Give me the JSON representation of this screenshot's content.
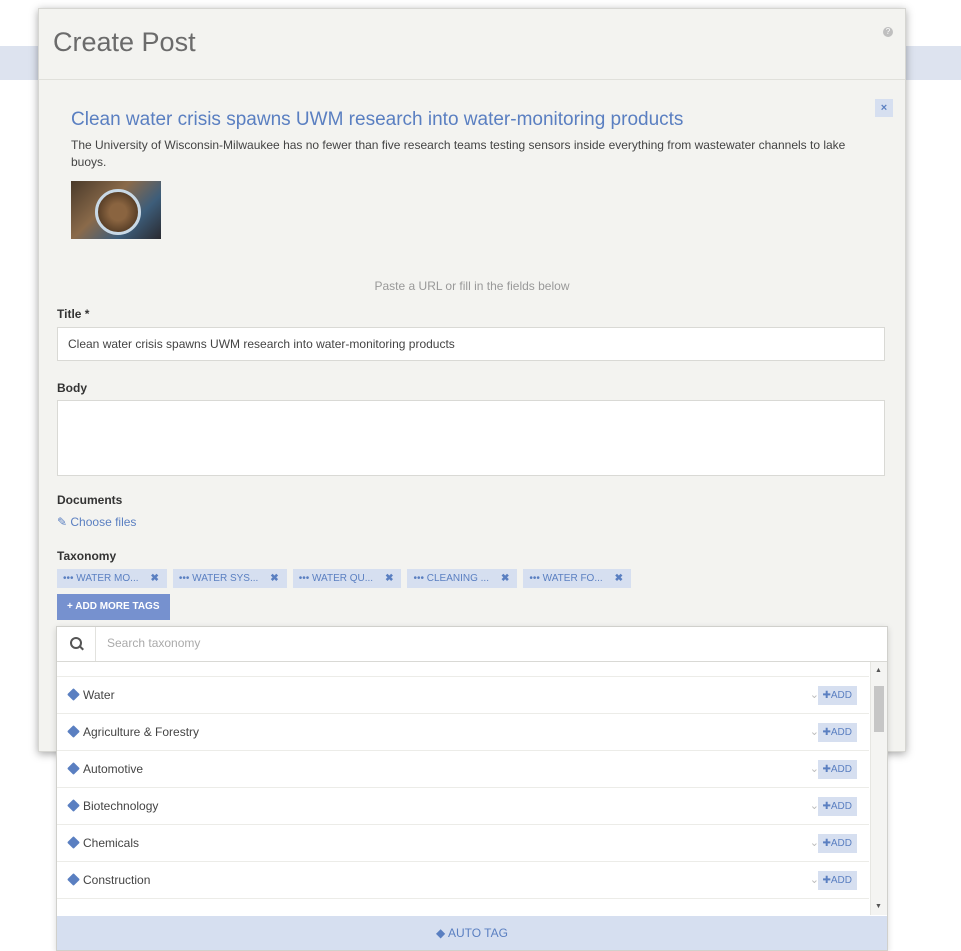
{
  "modal": {
    "title": "Create Post"
  },
  "preview": {
    "title": "Clean water crisis spawns UWM research into water-monitoring products",
    "description": "The University of Wisconsin-Milwaukee has no fewer than five research teams testing sensors inside everything from wastewater channels to lake buoys.",
    "close": "×"
  },
  "hint": "Paste a URL or fill in the fields below",
  "form": {
    "title_label": "Title *",
    "title_value": "Clean water crisis spawns UWM research into water-monitoring products",
    "body_label": "Body",
    "documents_label": "Documents",
    "choose_files": "✎ Choose files",
    "taxonomy_label": "Taxonomy",
    "tags": [
      "••• WATER MO...",
      "••• WATER SYS...",
      "••• WATER QU...",
      "••• CLEANING ...",
      "••• WATER FO..."
    ],
    "tag_remove": "✖",
    "add_more_tags": "+ ADD MORE TAGS"
  },
  "taxonomy": {
    "search_placeholder": "Search taxonomy",
    "items": [
      {
        "label": "Water"
      },
      {
        "label": "Agriculture & Forestry"
      },
      {
        "label": "Automotive"
      },
      {
        "label": "Biotechnology"
      },
      {
        "label": "Chemicals"
      },
      {
        "label": "Construction"
      }
    ],
    "add_label": "✚ADD",
    "chevron": "⌄",
    "auto_tag": "AUTO TAG"
  },
  "colors": {
    "accent": "#5a7fc1",
    "tag_bg": "#d6dff0",
    "button_bg": "#7691cf"
  }
}
